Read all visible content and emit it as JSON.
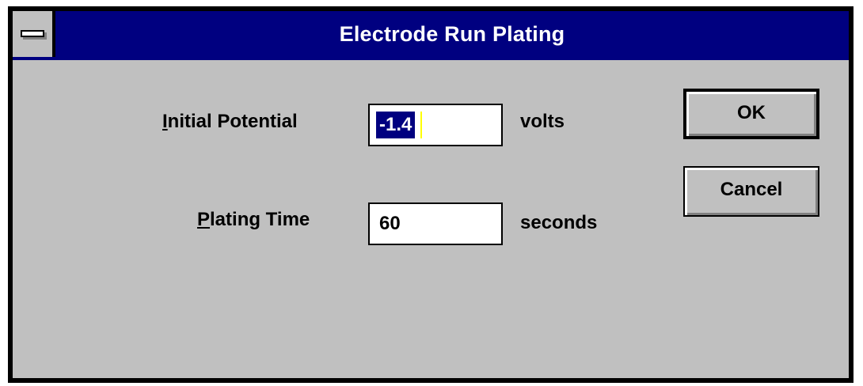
{
  "window": {
    "title": "Electrode Run Plating"
  },
  "fields": {
    "initial_potential": {
      "access_key": "I",
      "label_rest": "nitial Potential",
      "value": "-1.4",
      "unit": "volts"
    },
    "plating_time": {
      "access_key": "P",
      "label_rest": "lating Time",
      "value": "60",
      "unit": "seconds"
    }
  },
  "buttons": {
    "ok_label": "OK",
    "cancel_label": "Cancel"
  },
  "colors": {
    "titlebar": "#000080",
    "client": "#c0c0c0",
    "selection": "#000080"
  },
  "icons": {
    "system_menu": "system-menu-icon"
  }
}
